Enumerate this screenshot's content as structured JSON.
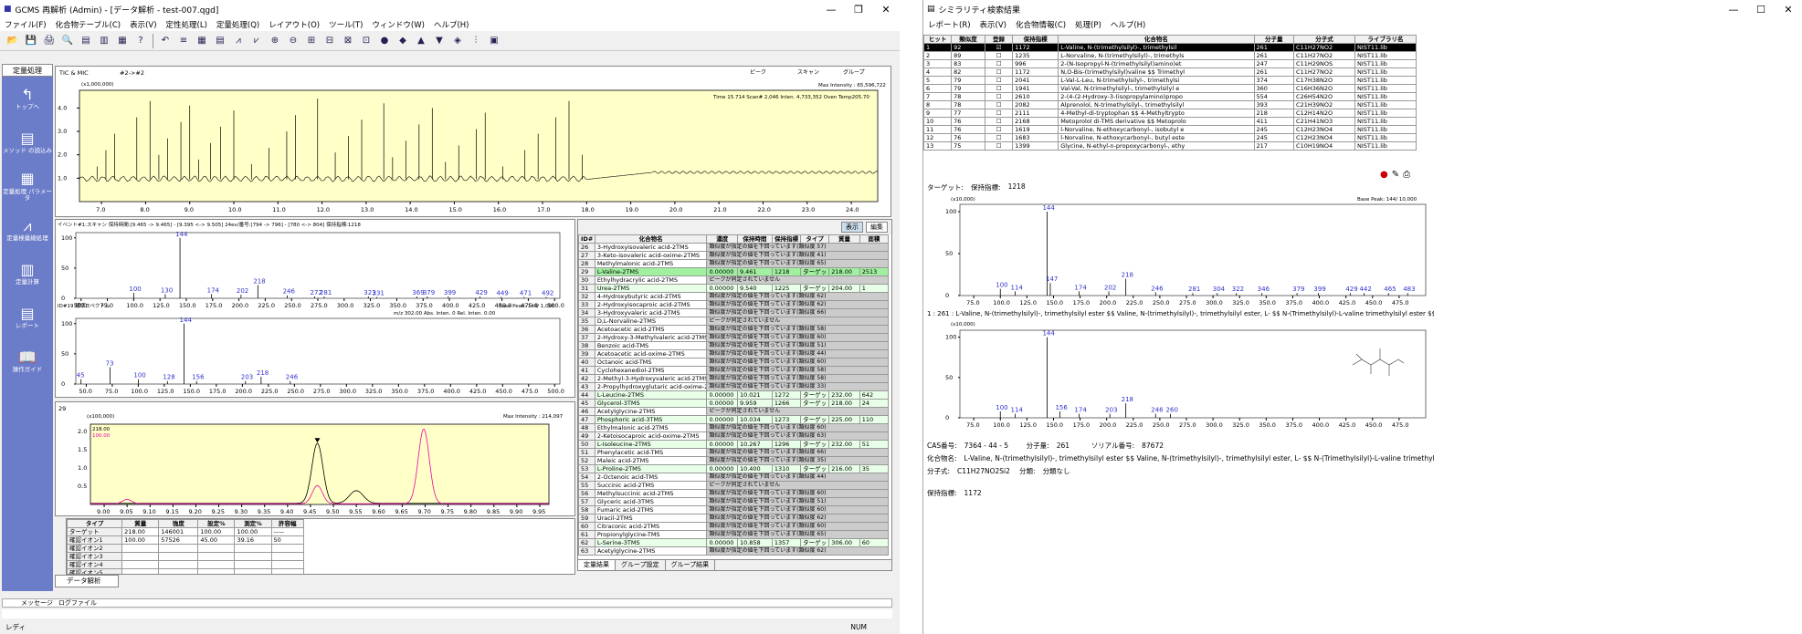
{
  "main": {
    "title": "GCMS 再解析 (Admin) - [データ解析 - test-007.qgd]",
    "menu": [
      "ファイル(F)",
      "化合物テーブル(C)",
      "表示(V)",
      "定性処理(L)",
      "定量処理(Q)",
      "レイアウト(O)",
      "ツール(T)",
      "ウィンドウ(W)",
      "ヘルプ(H)"
    ],
    "sidebar_title": "定量処理",
    "sidebar": [
      "トップへ",
      "メソッド の読込み",
      "定量処理 パラメータ",
      "定量検量線処理",
      "定量計算",
      "レポート",
      "操作ガイド"
    ],
    "tic_label": "TIC & MIC",
    "tic_sub": "#2->#2",
    "tic_unit": "(x1,000,000)",
    "tic_maxint": "Max Intensity : 65,596,722",
    "tic_info": "Time  15.714   Scan# 2,046   Inten.   4,733,352   Oven Temp205.70",
    "tic_nav": "ピーク",
    "tic_nav2": "スキャン",
    "tic_nav3": "グループ",
    "tic_y": [
      "4.0",
      "3.0",
      "2.0",
      "1.0"
    ],
    "tic_x": [
      "7.0",
      "8.0",
      "9.0",
      "10.0",
      "11.0",
      "12.0",
      "13.0",
      "14.0",
      "15.0",
      "16.0",
      "17.0",
      "18.0",
      "19.0",
      "20.0",
      "21.0",
      "22.0",
      "23.0",
      "24.0"
    ],
    "spec_header": "イベント#1:スキャン 保持時間:[9.465 -> 9.465] - [9.395 <-> 9.505] 24ev/番号:[794 -> 796] - [780 <-> 804]   保持指標:1218",
    "spec_ref_header": "ID#19 標準スペクトル",
    "spec_ref_info": "m/z  302.00  Abs. Inten.    0  Rel. Inten.  0.00",
    "spec_base": "Base Peak: 144/ 1,000",
    "spec_y": [
      "100",
      "50",
      "0"
    ],
    "spec_x": [
      "50.0",
      "75.0",
      "100.0",
      "125.0",
      "150.0",
      "175.0",
      "200.0",
      "225.0",
      "250.0",
      "275.0",
      "300.0",
      "325.0",
      "350.0",
      "375.0",
      "400.0",
      "425.0",
      "450.0",
      "475.0",
      "500.0"
    ],
    "spec_peaks": [
      {
        "mz": 100,
        "rel": 0.09
      },
      {
        "mz": 130,
        "rel": 0.07
      },
      {
        "mz": 144,
        "rel": 1.0
      },
      {
        "mz": 174,
        "rel": 0.07
      },
      {
        "mz": 202,
        "rel": 0.06
      },
      {
        "mz": 218,
        "rel": 0.22
      },
      {
        "mz": 246,
        "rel": 0.05
      },
      {
        "mz": 272,
        "rel": 0.03
      },
      {
        "mz": 281,
        "rel": 0.03
      },
      {
        "mz": 323,
        "rel": 0.03
      },
      {
        "mz": 331,
        "rel": 0.02
      },
      {
        "mz": 369,
        "rel": 0.03
      },
      {
        "mz": 379,
        "rel": 0.03
      },
      {
        "mz": 399,
        "rel": 0.03
      },
      {
        "mz": 429,
        "rel": 0.03
      },
      {
        "mz": 449,
        "rel": 0.02
      },
      {
        "mz": 471,
        "rel": 0.02
      },
      {
        "mz": 492,
        "rel": 0.02
      }
    ],
    "spec_labels": [
      "100",
      "130",
      "144",
      "174",
      "202",
      "218",
      "246",
      "272",
      "281",
      "323",
      "331",
      "369",
      "379",
      "399",
      "429",
      "449",
      "471",
      "492"
    ],
    "ref_peaks": [
      {
        "mz": 45,
        "rel": 0.08
      },
      {
        "mz": 73,
        "rel": 0.28
      },
      {
        "mz": 100,
        "rel": 0.08
      },
      {
        "mz": 128,
        "rel": 0.05
      },
      {
        "mz": 144,
        "rel": 1.0
      },
      {
        "mz": 156,
        "rel": 0.05
      },
      {
        "mz": 203,
        "rel": 0.05
      },
      {
        "mz": 218,
        "rel": 0.12
      },
      {
        "mz": 246,
        "rel": 0.05
      }
    ],
    "ref_labels": [
      "45",
      "73",
      "100",
      "128",
      "144",
      "156",
      "203",
      "218",
      "246"
    ],
    "mc_label": "29",
    "mc_unit": "(x100,000)",
    "mc_maxint": "Max Intensity : 214,097",
    "mc_legend": [
      "218.00",
      "100.00"
    ],
    "mc_x": [
      "9.00",
      "9.05",
      "9.10",
      "9.15",
      "9.20",
      "9.25",
      "9.30",
      "9.35",
      "9.40",
      "9.45",
      "9.50",
      "9.55",
      "9.60",
      "9.65",
      "9.70",
      "9.75",
      "9.80",
      "9.85",
      "9.90",
      "9.95"
    ],
    "mc_y": [
      "2.0",
      "1.5",
      "1.0",
      "0.5"
    ],
    "ion_headers": [
      "タイプ",
      "質量",
      "強度",
      "設定%",
      "測定%",
      "許容幅"
    ],
    "ion_rows": [
      [
        "ターゲット",
        "218.00",
        "146001",
        "100.00",
        "100.00",
        "-----"
      ],
      [
        "確認イオン1",
        "100.00",
        "57526",
        "45.00",
        "39.16",
        "50"
      ],
      [
        "確認イオン2",
        "",
        "",
        "",
        "",
        ""
      ],
      [
        "確認イオン3",
        "",
        "",
        "",
        "",
        ""
      ],
      [
        "確認イオン4",
        "",
        "",
        "",
        "",
        ""
      ],
      [
        "確認イオン5",
        "",
        "",
        "",
        "",
        ""
      ]
    ],
    "ct_headers": [
      "ID#",
      "化合物名",
      "濃度",
      "保持時間",
      "保持指標",
      "タイプ",
      "質量",
      "面積"
    ],
    "ct_rows": [
      [
        "26",
        "3-Hydroxyisovaleric acid-2TMS",
        "",
        "類似度が指定の値を下回っています(類似度 57)",
        "",
        "",
        "",
        ""
      ],
      [
        "27",
        "3-Keto-isovaleric acid-oxime-2TMS",
        "",
        "類似度が指定の値を下回っています(類似度 41)",
        "",
        "",
        "",
        ""
      ],
      [
        "28",
        "Methylmalonic acid-2TMS",
        "",
        "類似度が指定の値を下回っています(類似度 65)",
        "",
        "",
        "",
        ""
      ],
      [
        "29",
        "L-Valine-2TMS",
        "0.00000",
        "9.461",
        "1218",
        "ターゲット",
        "218.00",
        "2513"
      ],
      [
        "30",
        "Ethylhydracrylic acid-2TMS",
        "",
        "ピークが同定されていません",
        "",
        "",
        "",
        ""
      ],
      [
        "31",
        "Urea-2TMS",
        "0.00000",
        "9.540",
        "1225",
        "ターゲット",
        "204.00",
        "1"
      ],
      [
        "32",
        "4-Hydroxybutyric acid-2TMS",
        "",
        "類似度が指定の値を下回っています(類似度 62)",
        "",
        "",
        "",
        ""
      ],
      [
        "33",
        "2-Hydroxyisocaproic acid-2TMS",
        "",
        "類似度が指定の値を下回っています(類似度 62)",
        "",
        "",
        "",
        ""
      ],
      [
        "34",
        "3-Hydroxyvaleric acid-2TMS",
        "",
        "類似度が指定の値を下回っています(類似度 66)",
        "",
        "",
        "",
        ""
      ],
      [
        "35",
        "D,L-Norvaline-2TMS",
        "",
        "ピークが同定されていません",
        "",
        "",
        "",
        ""
      ],
      [
        "36",
        "Acetoacetic acid-2TMS",
        "",
        "類似度が指定の値を下回っています(類似度 58)",
        "",
        "",
        "",
        ""
      ],
      [
        "37",
        "2-Hydroxy-3-Methylvaleric acid-2TMS",
        "",
        "類似度が指定の値を下回っています(類似度 60)",
        "",
        "",
        "",
        ""
      ],
      [
        "38",
        "Benzoic acid-TMS",
        "",
        "類似度が指定の値を下回っています(類似度 51)",
        "",
        "",
        "",
        ""
      ],
      [
        "39",
        "Acetoacetic acid-oxime-2TMS",
        "",
        "類似度が指定の値を下回っています(類似度 44)",
        "",
        "",
        "",
        ""
      ],
      [
        "40",
        "Octanoic acid-TMS",
        "",
        "類似度が指定の値を下回っています(類似度 60)",
        "",
        "",
        "",
        ""
      ],
      [
        "41",
        "Cyclohexanediol-2TMS",
        "",
        "類似度が指定の値を下回っています(類似度 58)",
        "",
        "",
        "",
        ""
      ],
      [
        "42",
        "2-Methyl-3-Hydroxyvaleric acid-2TMS",
        "",
        "類似度が指定の値を下回っています(類似度 58)",
        "",
        "",
        "",
        ""
      ],
      [
        "43",
        "2-Propylhydroxyglutaric acid-oxime-2",
        "",
        "類似度が指定の値を下回っています(類似度 33)",
        "",
        "",
        "",
        ""
      ],
      [
        "44",
        "L-Leucine-2TMS",
        "0.00000",
        "10.021",
        "1272",
        "ターゲット",
        "232.00",
        "642"
      ],
      [
        "45",
        "Glycerol-3TMS",
        "0.00000",
        "9.959",
        "1266",
        "ターゲット",
        "218.00",
        "24"
      ],
      [
        "46",
        "Acetylglycine-2TMS",
        "",
        "ピークが同定されていません",
        "",
        "",
        "",
        ""
      ],
      [
        "47",
        "Phosphoric acid-3TMS",
        "0.00000",
        "10.034",
        "1273",
        "ターゲット",
        "225.00",
        "110"
      ],
      [
        "48",
        "Ethylmalonic acid-2TMS",
        "",
        "類似度が指定の値を下回っています(類似度 60)",
        "",
        "",
        "",
        ""
      ],
      [
        "49",
        "2-Ketoisocaproic acid-oxime-2TMS",
        "",
        "類似度が指定の値を下回っています(類似度 63)",
        "",
        "",
        "",
        ""
      ],
      [
        "50",
        "L-Isoleucine-2TMS",
        "0.00000",
        "10.267",
        "1296",
        "ターゲット",
        "232.00",
        "51"
      ],
      [
        "51",
        "Phenylacetic acid-TMS",
        "",
        "類似度が指定の値を下回っています(類似度 66)",
        "",
        "",
        "",
        ""
      ],
      [
        "52",
        "Maleic acid-2TMS",
        "",
        "類似度が指定の値を下回っています(類似度 35)",
        "",
        "",
        "",
        ""
      ],
      [
        "53",
        "L-Proline-2TMS",
        "0.00000",
        "10.400",
        "1310",
        "ターゲット",
        "216.00",
        "35"
      ],
      [
        "54",
        "2-Octenoic acid-TMS",
        "",
        "類似度が指定の値を下回っています(類似度 44)",
        "",
        "",
        "",
        ""
      ],
      [
        "55",
        "Succinic acid-2TMS",
        "",
        "ピークが同定されていません",
        "",
        "",
        "",
        ""
      ],
      [
        "56",
        "Methylsuccinic acid-2TMS",
        "",
        "類似度が指定の値を下回っています(類似度 60)",
        "",
        "",
        "",
        ""
      ],
      [
        "57",
        "Glyceric acid-3TMS",
        "",
        "類似度が指定の値を下回っています(類似度 51)",
        "",
        "",
        "",
        ""
      ],
      [
        "58",
        "Fumaric acid-2TMS",
        "",
        "類似度が指定の値を下回っています(類似度 60)",
        "",
        "",
        "",
        ""
      ],
      [
        "59",
        "Uracil-2TMS",
        "",
        "類似度が指定の値を下回っています(類似度 62)",
        "",
        "",
        "",
        ""
      ],
      [
        "60",
        "Citraconic acid-2TMS",
        "",
        "類似度が指定の値を下回っています(類似度 60)",
        "",
        "",
        "",
        ""
      ],
      [
        "61",
        "Propionylglycine-TMS",
        "",
        "類似度が指定の値を下回っています(類似度 65)",
        "",
        "",
        "",
        ""
      ],
      [
        "62",
        "L-Serine-3TMS",
        "0.00000",
        "10.858",
        "1357",
        "ターゲット",
        "306.00",
        "60"
      ],
      [
        "63",
        "Acetylglycine-2TMS",
        "",
        "類似度が指定の値を下回っています(類似度 62)",
        "",
        "",
        "",
        ""
      ]
    ],
    "ct_tabs": [
      "定量結果",
      "グループ設定",
      "グループ結果"
    ],
    "ct_btn1": "表示",
    "ct_btn2": "編集",
    "doc_tab": "データ解析",
    "bottom_tabs": [
      "メッセージ",
      "ログファイル"
    ],
    "status_left": "レディ",
    "status_right": "NUM"
  },
  "search": {
    "title": "シミラリティ検索結果",
    "menu": [
      "レポート(R)",
      "表示(V)",
      "化合物情報(C)",
      "処理(P)",
      "ヘルプ(H)"
    ],
    "headers": [
      "ヒット",
      "類似度",
      "登録",
      "保持指標",
      "化合物名",
      "分子量",
      "分子式",
      "ライブラリ名"
    ],
    "rows": [
      [
        "1",
        "92",
        "✓",
        "1172",
        "L-Valine, N-(trimethylsilyl)-, trimethylsil",
        "261",
        "C11H27NO2",
        "NIST11.lib"
      ],
      [
        "2",
        "89",
        "",
        "1235",
        "L-Norvaline, N-(trimethylsilyl)-, trimethyls",
        "261",
        "C11H27NO2",
        "NIST11.lib"
      ],
      [
        "3",
        "83",
        "",
        "996",
        "2-(N-Isopropyl-N-(trimethylsilyl)amino)et",
        "247",
        "C11H29NOS",
        "NIST11.lib"
      ],
      [
        "4",
        "82",
        "",
        "1172",
        "N,O-Bis-(trimethylsilyl)valine $$ Trimethyl",
        "261",
        "C11H27NO2",
        "NIST11.lib"
      ],
      [
        "5",
        "79",
        "",
        "2041",
        "L-Val-L-Leu, N-trimethylsilyl-, trimethylsi",
        "374",
        "C17H38N2O",
        "NIST11.lib"
      ],
      [
        "6",
        "79",
        "",
        "1941",
        "Val-Val, N-trimethylsilyl-, trimethylsilyl e",
        "360",
        "C16H36N2O",
        "NIST11.lib"
      ],
      [
        "7",
        "78",
        "",
        "2610",
        "2-(4-(2-Hydroxy-3-(isopropylamino)propo",
        "554",
        "C26H54N2O",
        "NIST11.lib"
      ],
      [
        "8",
        "78",
        "",
        "2082",
        "Alprenolol, N-trimethylsilyl-, trimethylsilyl",
        "393",
        "C21H39NO2",
        "NIST11.lib"
      ],
      [
        "9",
        "77",
        "",
        "2111",
        "4-Methyl-di-tryptophan $$ 4-Methyltrypto",
        "218",
        "C12H14N2O",
        "NIST11.lib"
      ],
      [
        "10",
        "76",
        "",
        "2168",
        "Metoprolol di-TMS derivative $$ Metoprolo",
        "411",
        "C21H41NO3",
        "NIST11.lib"
      ],
      [
        "11",
        "76",
        "",
        "1619",
        "l-Norvaline, N-ethoxycarbonyl-, isobutyl e",
        "245",
        "C12H23NO4",
        "NIST11.lib"
      ],
      [
        "12",
        "76",
        "",
        "1683",
        "l-Norvaline, N-ethoxycarbonyl-, butyl este",
        "245",
        "C12H23NO4",
        "NIST11.lib"
      ],
      [
        "13",
        "75",
        "",
        "1399",
        "Glycine, N-ethyl-n-propoxycarbonyl-, ethy",
        "217",
        "C10H19NO4",
        "NIST11.lib"
      ]
    ],
    "target_label": "ターゲット:",
    "target_ri": "保持指標:",
    "target_ri_val": "1218",
    "unit": "(x10,000)",
    "base": "Base Peak: 144/ 10,000",
    "y": [
      "100",
      "50",
      "0"
    ],
    "x": [
      "75.0",
      "100.0",
      "125.0",
      "150.0",
      "175.0",
      "200.0",
      "225.0",
      "250.0",
      "275.0",
      "300.0",
      "325.0",
      "350.0",
      "375.0",
      "400.0",
      "425.0",
      "450.0",
      "475.0"
    ],
    "t_peaks": [
      {
        "mz": 100,
        "rel": 0.08
      },
      {
        "mz": 114,
        "rel": 0.05
      },
      {
        "mz": 144,
        "rel": 1.0
      },
      {
        "mz": 147,
        "rel": 0.15
      },
      {
        "mz": 174,
        "rel": 0.05
      },
      {
        "mz": 202,
        "rel": 0.05
      },
      {
        "mz": 218,
        "rel": 0.2
      },
      {
        "mz": 246,
        "rel": 0.04
      },
      {
        "mz": 281,
        "rel": 0.03
      },
      {
        "mz": 304,
        "rel": 0.03
      },
      {
        "mz": 322,
        "rel": 0.03
      },
      {
        "mz": 346,
        "rel": 0.03
      },
      {
        "mz": 379,
        "rel": 0.03
      },
      {
        "mz": 399,
        "rel": 0.03
      },
      {
        "mz": 429,
        "rel": 0.03
      },
      {
        "mz": 442,
        "rel": 0.03
      },
      {
        "mz": 465,
        "rel": 0.03
      },
      {
        "mz": 483,
        "rel": 0.03
      }
    ],
    "t_labels": [
      "100",
      "114",
      "144",
      "147",
      "174",
      "202",
      "218",
      "246",
      "281",
      "304",
      "322",
      "346",
      "379",
      "399",
      "429",
      "442",
      "465",
      "483"
    ],
    "hit_line": "1 : 261 : L-Valine, N-(trimethylsilyl)-, trimethylsilyl ester $$ Valine, N-(trimethylsilyl)-, trimethylsilyl ester, L- $$ N-(Trimethylsilyl)-L-valine trimethylsilyl ester $$ N,O-Bis-(trime",
    "l_peaks": [
      {
        "mz": 100,
        "rel": 0.08
      },
      {
        "mz": 114,
        "rel": 0.05
      },
      {
        "mz": 144,
        "rel": 1.0
      },
      {
        "mz": 156,
        "rel": 0.08
      },
      {
        "mz": 174,
        "rel": 0.05
      },
      {
        "mz": 203,
        "rel": 0.05
      },
      {
        "mz": 218,
        "rel": 0.18
      },
      {
        "mz": 246,
        "rel": 0.05
      },
      {
        "mz": 260,
        "rel": 0.05
      }
    ],
    "l_labels": [
      "100",
      "114",
      "156",
      "174",
      "203",
      "218",
      "246",
      "260"
    ],
    "l_top": "144",
    "cas_label": "CAS番号:",
    "cas": "7364 - 44 - 5",
    "mw_label": "分子量:",
    "mw": "261",
    "sid_label": "ソリアル番号:",
    "sid": "87672",
    "name_label": "化合物名:",
    "name": "L-Valine, N-(trimethylsilyl)-, trimethylsilyl ester $$ Valine, N-(trimethylsilyl)-, trimethylsilyl ester, L- $$ N-(Trimethylsilyl)-L-valine trimethylsilyl ester $$ N,O-Bis-(trim",
    "formula_label": "分子式:",
    "formula": "C11H27NO2Si2",
    "class_label": "分類:",
    "class": "分類なし",
    "ri_label": "保持指標:",
    "ri": "1172"
  }
}
